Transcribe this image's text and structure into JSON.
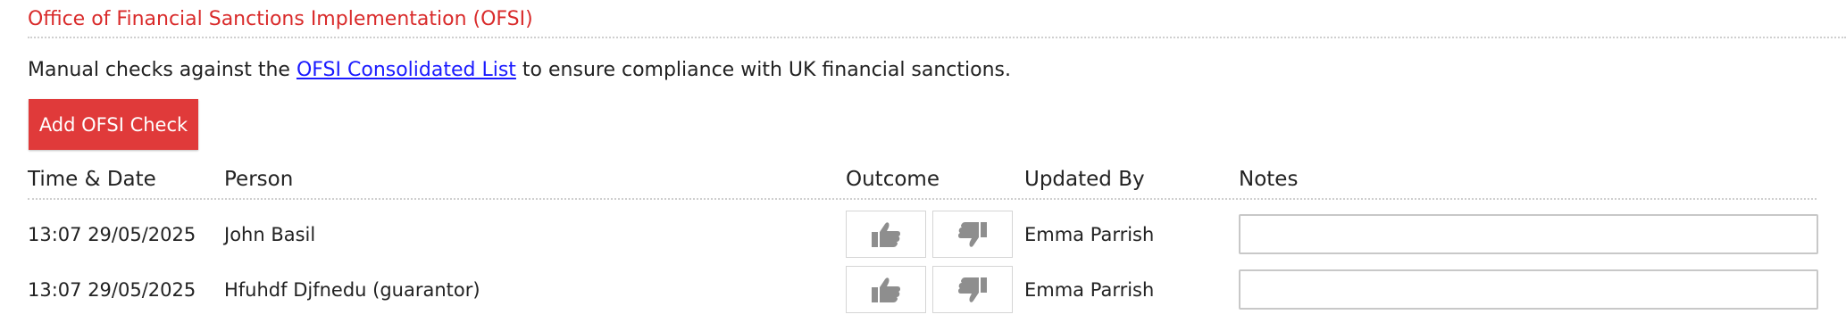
{
  "section": {
    "title": "Office of Financial Sanctions Implementation (OFSI)"
  },
  "intro": {
    "before": "Manual checks against the ",
    "link": "OFSI Consolidated List",
    "after": " to ensure compliance with UK financial sanctions."
  },
  "actions": {
    "add_label": "Add OFSI Check"
  },
  "table": {
    "headers": {
      "time_date": "Time & Date",
      "person": "Person",
      "outcome": "Outcome",
      "updated_by": "Updated By",
      "notes": "Notes"
    },
    "rows": [
      {
        "time_date": "13:07 29/05/2025",
        "person": "John Basil",
        "updated_by": "Emma Parrish",
        "notes": ""
      },
      {
        "time_date": "13:07 29/05/2025",
        "person": "Hfuhdf Djfnedu (guarantor)",
        "updated_by": "Emma Parrish",
        "notes": ""
      }
    ]
  },
  "icons": {
    "approve": "thumbs-up-icon",
    "reject": "thumbs-down-icon"
  },
  "colors": {
    "accent": "#d92b2b",
    "button": "#e03a3a",
    "link": "#1a1aff",
    "icon": "#8e8e8e"
  }
}
